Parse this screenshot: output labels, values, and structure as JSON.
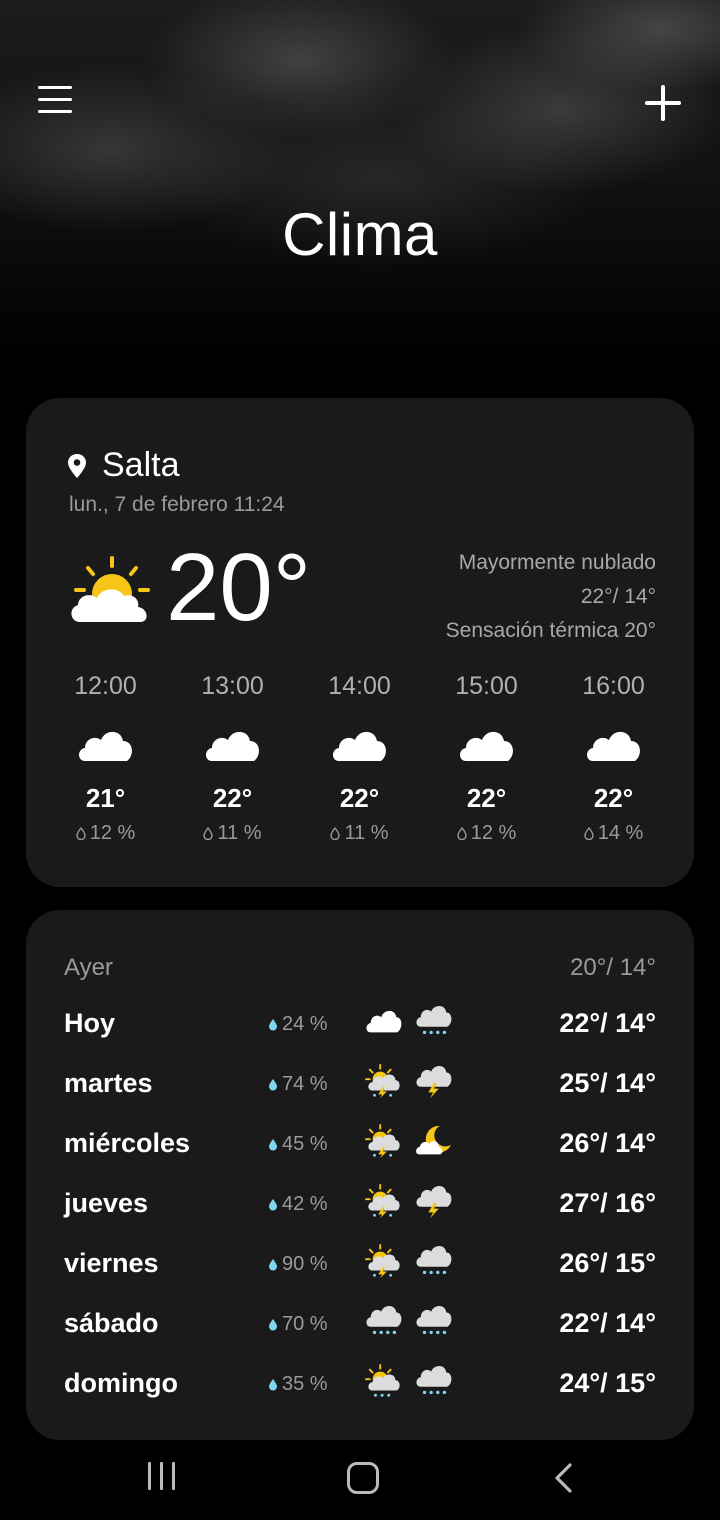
{
  "header": {
    "title": "Clima",
    "menu_icon": "hamburger-menu-icon",
    "add_icon": "plus-icon"
  },
  "current": {
    "location": "Salta",
    "datetime": "lun., 7 de febrero 11:24",
    "temperature": "20°",
    "condition": "Mayormente nublado",
    "high_low": "22°/ 14°",
    "feels_like": "Sensación térmica 20°",
    "icon": "partly-cloudy-sun-icon"
  },
  "hourly": [
    {
      "time": "12:00",
      "temp": "21°",
      "precip": "12 %",
      "icon": "cloud-icon"
    },
    {
      "time": "13:00",
      "temp": "22°",
      "precip": "11 %",
      "icon": "cloud-icon"
    },
    {
      "time": "14:00",
      "temp": "22°",
      "precip": "11 %",
      "icon": "cloud-icon"
    },
    {
      "time": "15:00",
      "temp": "22°",
      "precip": "12 %",
      "icon": "cloud-icon"
    },
    {
      "time": "16:00",
      "temp": "22°",
      "precip": "14 %",
      "icon": "cloud-icon"
    }
  ],
  "yesterday": {
    "label": "Ayer",
    "temps": "20°/ 14°"
  },
  "daily": [
    {
      "day": "Hoy",
      "precip": "24 %",
      "icon_day": "cloud-icon",
      "icon_night": "rain-cloud-icon",
      "temps": "22°/ 14°"
    },
    {
      "day": "martes",
      "precip": "74 %",
      "icon_day": "sun-thunderstorm-icon",
      "icon_night": "thunder-cloud-icon",
      "temps": "25°/ 14°"
    },
    {
      "day": "miércoles",
      "precip": "45 %",
      "icon_day": "sun-thunderstorm-icon",
      "icon_night": "moon-cloud-icon",
      "temps": "26°/ 14°"
    },
    {
      "day": "jueves",
      "precip": "42 %",
      "icon_day": "sun-thunderstorm-icon",
      "icon_night": "thunder-cloud-icon",
      "temps": "27°/ 16°"
    },
    {
      "day": "viernes",
      "precip": "90 %",
      "icon_day": "sun-thunderstorm-icon",
      "icon_night": "rain-cloud-icon",
      "temps": "26°/ 15°"
    },
    {
      "day": "sábado",
      "precip": "70 %",
      "icon_day": "rain-cloud-icon",
      "icon_night": "rain-cloud-icon",
      "temps": "22°/ 14°"
    },
    {
      "day": "domingo",
      "precip": "35 %",
      "icon_day": "sun-rain-icon",
      "icon_night": "rain-cloud-icon",
      "temps": "24°/ 15°"
    }
  ],
  "navbar": {
    "recents_icon": "recents-icon",
    "home_icon": "home-icon",
    "back_icon": "back-icon"
  },
  "colors": {
    "background": "#000000",
    "card": "#1a1a1a",
    "sun": "#f5c518",
    "drop": "#7fd6f0"
  }
}
